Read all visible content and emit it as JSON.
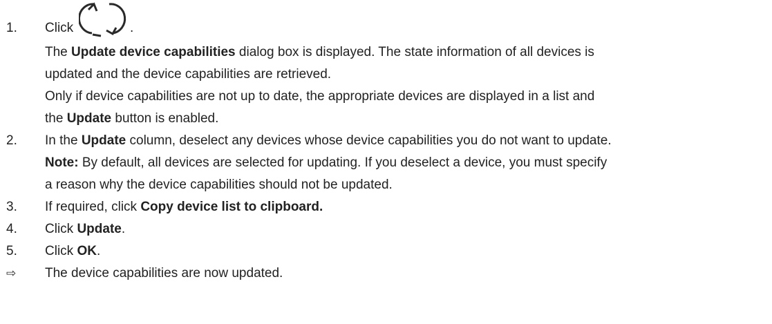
{
  "step1": {
    "number": "1.",
    "click": "Click",
    "period": ".",
    "icon": "refresh-icon",
    "desc1_pre": "The ",
    "desc1_bold": "Update device capabilities",
    "desc1_post": " dialog box is displayed. The state information of all devices is",
    "desc2": "updated and the device capabilities are retrieved.",
    "desc3": "Only if device capabilities are not up to date, the appropriate devices are displayed in a list and",
    "desc4_pre": "the ",
    "desc4_bold": "Update",
    "desc4_post": " button is enabled."
  },
  "step2": {
    "number": "2.",
    "line1_pre": "In the ",
    "line1_bold": "Update",
    "line1_post": " column, deselect any devices whose device capabilities you do not want to update.",
    "note_label": "Note:",
    "note_text": " By default, all devices are selected for updating. If you deselect a device, you must specify",
    "note_line2": "a reason why the device capabilities should not be updated."
  },
  "step3": {
    "number": "3.",
    "pre": "If required, click ",
    "bold": "Copy device list to clipboard."
  },
  "step4": {
    "number": "4.",
    "pre": "Click ",
    "bold": "Update",
    "post": "."
  },
  "step5": {
    "number": "5.",
    "pre": "Click ",
    "bold": "OK",
    "post": "."
  },
  "result": {
    "arrow": "⇨",
    "text": "The device capabilities are now updated."
  }
}
